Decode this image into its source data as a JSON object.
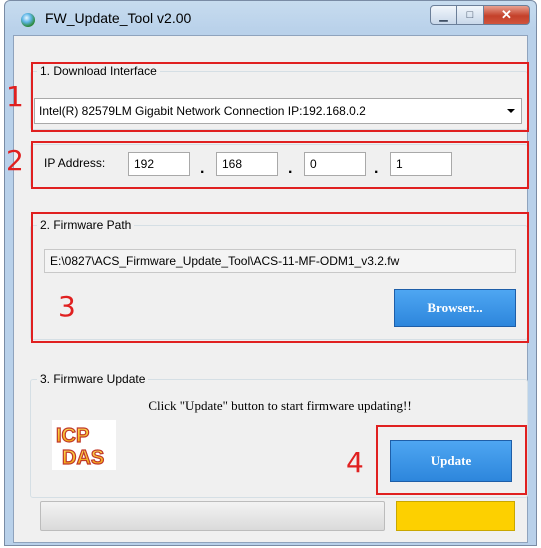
{
  "window": {
    "title": "FW_Update_Tool v2.00",
    "minimize_icon": "minimize-icon",
    "maximize_icon": "maximize-icon",
    "close_icon": "close-icon"
  },
  "download_interface": {
    "legend": "1. Download Interface",
    "selected": "Intel(R) 82579LM Gigabit Network Connection   IP:192.168.0.2"
  },
  "ip": {
    "label": "IP Address:",
    "octets": [
      "192",
      "168",
      "0",
      "1"
    ],
    "separator": "."
  },
  "firmware_path": {
    "legend": "2. Firmware Path",
    "value": "E:\\0827\\ACS_Firmware_Update_Tool\\ACS-11-MF-ODM1_v3.2.fw",
    "browse_label": "Browser..."
  },
  "firmware_update": {
    "legend": "3. Firmware Update",
    "instruction": "Click \"Update\" button to start firmware updating!!",
    "update_label": "Update",
    "progress": 0
  },
  "logo": {
    "line1": "ICP",
    "line2": "DAS"
  },
  "annotations": {
    "n1": "1",
    "n2": "2",
    "n3": "3",
    "n4": "4"
  },
  "colors": {
    "accent_blue": "#2d86dc",
    "annotation_red": "#e02020",
    "status_yellow": "#fdd000"
  }
}
